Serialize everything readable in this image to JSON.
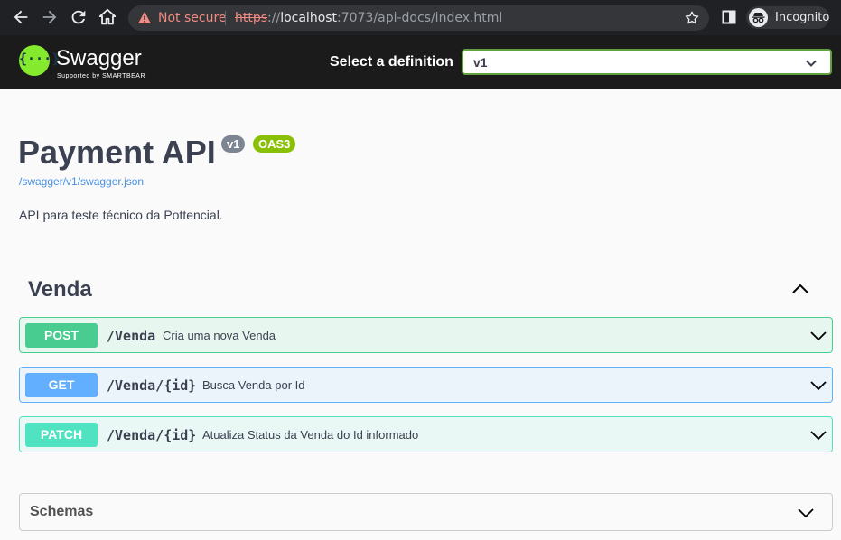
{
  "browser": {
    "security_label": "Not secure",
    "url_scheme": "https",
    "url_sep": "://",
    "url_host": "localhost",
    "url_rest": ":7073/api-docs/index.html",
    "incognito_label": "Incognito"
  },
  "topbar": {
    "logo_text": "Swagger",
    "logo_sub": "Supported by SMARTBEAR",
    "definition_label": "Select a definition",
    "definition_value": "v1"
  },
  "info": {
    "title": "Payment API",
    "version_badge": "v1",
    "oas_badge": "OAS3",
    "spec_link": "/swagger/v1/swagger.json",
    "description": "API para teste técnico da Pottencial."
  },
  "tag": {
    "name": "Venda",
    "operations": [
      {
        "method": "POST",
        "path": "/Venda",
        "summary": "Cria uma nova Venda"
      },
      {
        "method": "GET",
        "path": "/Venda/{id}",
        "summary": "Busca Venda por Id"
      },
      {
        "method": "PATCH",
        "path": "/Venda/{id}",
        "summary": "Atualiza Status da Venda do Id informado"
      }
    ]
  },
  "schemas": {
    "label": "Schemas"
  },
  "colors": {
    "post": "#49cc90",
    "get": "#61affe",
    "patch": "#50e3c2",
    "brand_green": "#85ea2d",
    "oas_badge": "#89bf04"
  }
}
